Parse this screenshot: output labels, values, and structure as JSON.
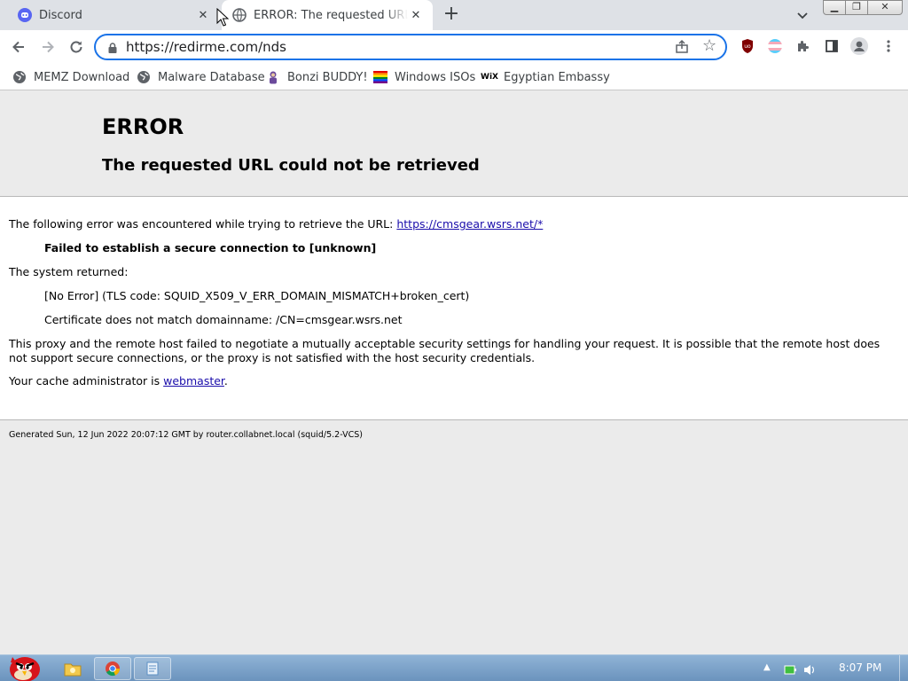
{
  "browser": {
    "tabs": [
      {
        "title": "Discord",
        "active": false,
        "icon": "discord-icon"
      },
      {
        "title": "ERROR: The requested URL could not be retrieved",
        "active": true,
        "icon": "globe-icon"
      }
    ],
    "address_bar": {
      "url": "https://redirme.com/nds"
    },
    "bookmarks": [
      {
        "label": "MEMZ Download",
        "icon": "globe-icon"
      },
      {
        "label": "Malware Database",
        "icon": "globe-icon"
      },
      {
        "label": "Bonzi BUDDY!",
        "icon": "bonzi-icon"
      },
      {
        "label": "Windows ISOs",
        "icon": "rainbow-flag-icon"
      },
      {
        "label": "Egyptian Embassy",
        "icon": "wix-icon"
      }
    ],
    "wix_label": "WiX"
  },
  "page": {
    "title": "ERROR",
    "subtitle": "The requested URL could not be retrieved",
    "intro": "The following error was encountered while trying to retrieve the URL:",
    "intro_link": "https://cmsgear.wsrs.net/*",
    "failure": "Failed to establish a secure connection to [unknown]",
    "system_returned": "The system returned:",
    "tls_error": "[No Error] (TLS code: SQUID_X509_V_ERR_DOMAIN_MISMATCH+broken_cert)",
    "cert_error": "Certificate does not match domainname: /CN=cmsgear.wsrs.net",
    "explanation": "This proxy and the remote host failed to negotiate a mutually acceptable security settings for handling your request. It is possible that the remote host does not support secure connections, or the proxy is not satisfied with the host security credentials.",
    "admin_prefix": "Your cache administrator is",
    "admin_link": "webmaster",
    "admin_suffix": ".",
    "footer": "Generated Sun, 12 Jun 2022 20:07:12 GMT by router.collabnet.local (squid/5.2-VCS)"
  },
  "taskbar": {
    "clock": "8:07 PM"
  },
  "colors": {
    "accent": "#1a73e8",
    "link": "#1a0dab",
    "discord": "#5865f2",
    "ublock": "#800000"
  }
}
